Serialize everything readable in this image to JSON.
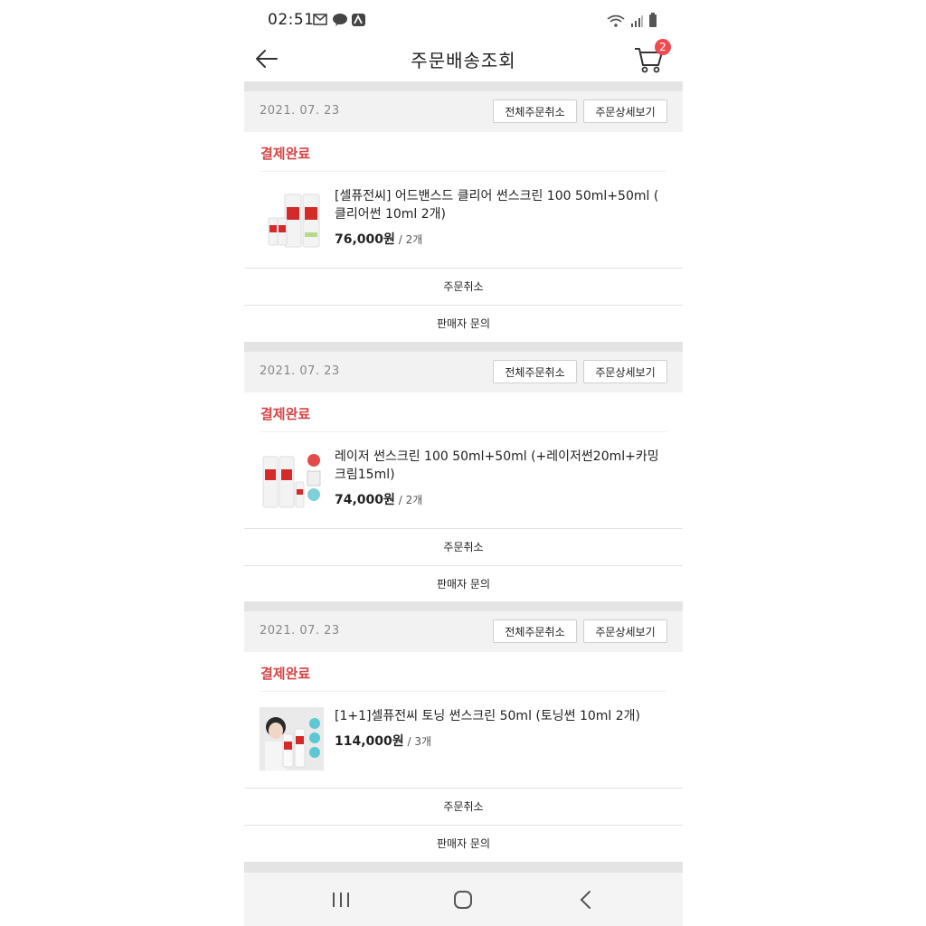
{
  "status_bar": {
    "time": "02:51"
  },
  "header": {
    "title": "주문배송조회",
    "cart_count": "2"
  },
  "orders": [
    {
      "date": "2021. 07. 23",
      "cancel_all_label": "전체주문취소",
      "detail_label": "주문상세보기",
      "status": "결제완료",
      "product_name": "[셀퓨전씨] 어드밴스드 클리어 썬스크린 100 50ml+50ml ( 클리어썬 10ml 2개)",
      "price": "76,000원",
      "qty": " / 2개",
      "cancel_label": "주문취소",
      "inquiry_label": "판매자 문의"
    },
    {
      "date": "2021. 07. 23",
      "cancel_all_label": "전체주문취소",
      "detail_label": "주문상세보기",
      "status": "결제완료",
      "product_name": "레이저 썬스크린 100 50ml+50ml (+레이저썬20ml+카밍크림15ml)",
      "price": "74,000원",
      "qty": " / 2개",
      "cancel_label": "주문취소",
      "inquiry_label": "판매자 문의"
    },
    {
      "date": "2021. 07. 23",
      "cancel_all_label": "전체주문취소",
      "detail_label": "주문상세보기",
      "status": "결제완료",
      "product_name": "[1+1]셀퓨전씨 토닝 썬스크린 50ml (토닝썬 10ml 2개)",
      "price": "114,000원",
      "qty": " / 3개",
      "cancel_label": "주문취소",
      "inquiry_label": "판매자 문의"
    }
  ],
  "colors": {
    "accent": "#d64545",
    "badge": "#f04a4f",
    "separator": "#e4e4e4",
    "header_bg": "#f2f2f2"
  },
  "icons": [
    "back-arrow-icon",
    "cart-icon",
    "wifi-icon",
    "signal-icon",
    "battery-icon",
    "recent-apps-icon",
    "home-icon",
    "nav-back-icon"
  ]
}
